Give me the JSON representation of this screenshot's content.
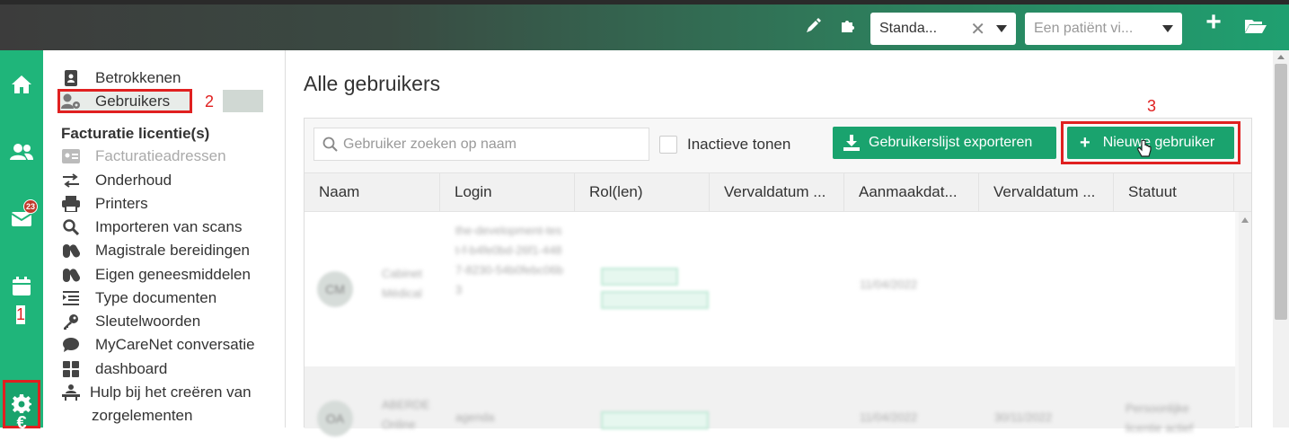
{
  "topbar": {
    "template_select": {
      "value": "Standa...",
      "clear": "✕"
    },
    "patient_select": {
      "placeholder": "Een patiënt vi..."
    },
    "add": "+"
  },
  "rail": {
    "mail_badge": "23",
    "annotation_1": "1"
  },
  "sidemenu": {
    "items_top": [
      {
        "label": "Betrokkenen"
      },
      {
        "label": "Gebruikers"
      }
    ],
    "annotation_2": "2",
    "section_title": "Facturatie licentie(s)",
    "items": [
      {
        "label": "Facturatieadressen",
        "disabled": true
      },
      {
        "label": "Onderhoud"
      },
      {
        "label": "Printers"
      },
      {
        "label": "Importeren van scans"
      },
      {
        "label": "Magistrale bereidingen"
      },
      {
        "label": "Eigen geneesmiddelen"
      },
      {
        "label": "Type documenten"
      },
      {
        "label": "Sleutelwoorden"
      },
      {
        "label": "MyCareNet conversatie"
      },
      {
        "label": "dashboard"
      },
      {
        "label": "Hulp bij het creëren van"
      },
      {
        "label": "zorgelementen"
      }
    ]
  },
  "main": {
    "title": "Alle gebruikers",
    "search_placeholder": "Gebruiker zoeken op naam",
    "inactive_label": "Inactieve tonen",
    "export_button": "Gebruikerslijst exporteren",
    "new_user_button": "Nieuwe gebruiker",
    "annotation_3": "3",
    "columns": [
      "Naam",
      "Login",
      "Rol(len)",
      "Vervaldatum ...",
      "Aanmaakdat...",
      "Vervaldatum ...",
      "Statuut"
    ],
    "rows": [
      {
        "initials": "CM",
        "name": "Cabinet Médical",
        "login": "the-development-test-f-b4fe0bd-26f1-4487-8230-54b0febc06b3",
        "roles": [
          "Beheerder",
          "Zorgverstrekker"
        ],
        "created": "11/04/2022"
      },
      {
        "initials": "OA",
        "name": "ABERDE Online",
        "login": "agenda",
        "roles": [
          "Zorgverstrekker"
        ],
        "created": "11/04/2022",
        "expiry": "30/11/2022",
        "status": "Persoonlijke licentie actief"
      }
    ]
  }
}
